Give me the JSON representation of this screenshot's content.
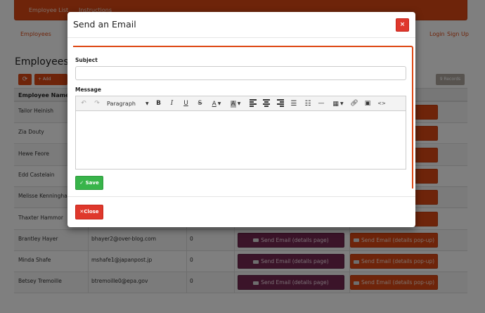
{
  "nav": {
    "employee_list": "Employee List",
    "instructions": "Instructions",
    "employees_link": "Employees",
    "login": "Login",
    "signup": "Sign Up"
  },
  "page": {
    "title": "Employees",
    "refresh_icon": "refresh-icon",
    "add_employee_label": "+ Add Emplo",
    "records": "9 Records"
  },
  "table": {
    "header_name": "Employee Name",
    "rows": [
      {
        "name": "Tailor Heinish",
        "email": "",
        "count": ""
      },
      {
        "name": "Zia Douty",
        "email": "",
        "count": ""
      },
      {
        "name": "Hewe Feore",
        "email": "",
        "count": ""
      },
      {
        "name": "Edd Castelain",
        "email": "",
        "count": ""
      },
      {
        "name": "Melisse Kenningham",
        "email": "",
        "count": ""
      },
      {
        "name": "Thaxter Hammor",
        "email": "",
        "count": ""
      },
      {
        "name": "Brantley Hayer",
        "email": "bhayer2@over-blog.com",
        "count": "0"
      },
      {
        "name": "Minda Shafe",
        "email": "mshafe1@japanpost.jp",
        "count": "0"
      },
      {
        "name": "Betsey Tremoille",
        "email": "btremoille0@epa.gov",
        "count": "0"
      }
    ],
    "details_btn": "Send Email (details page)",
    "popup_btn": "Send Email (details pop-up)",
    "popup_btn_partial": "up)"
  },
  "modal": {
    "title": "Send an Email",
    "close_x": "×",
    "subject_label": "Subject",
    "subject_value": "",
    "message_label": "Message",
    "paragraph": "Paragraph",
    "bold": "B",
    "italic": "I",
    "underline": "U",
    "strike": "S",
    "font_color": "A",
    "highlight": "A",
    "code": "<>",
    "save_label": "Save",
    "close_label": "Close"
  },
  "colors": {
    "brand": "#dd4814",
    "aubergine": "#772953",
    "danger": "#df382c",
    "success": "#38b44a"
  }
}
